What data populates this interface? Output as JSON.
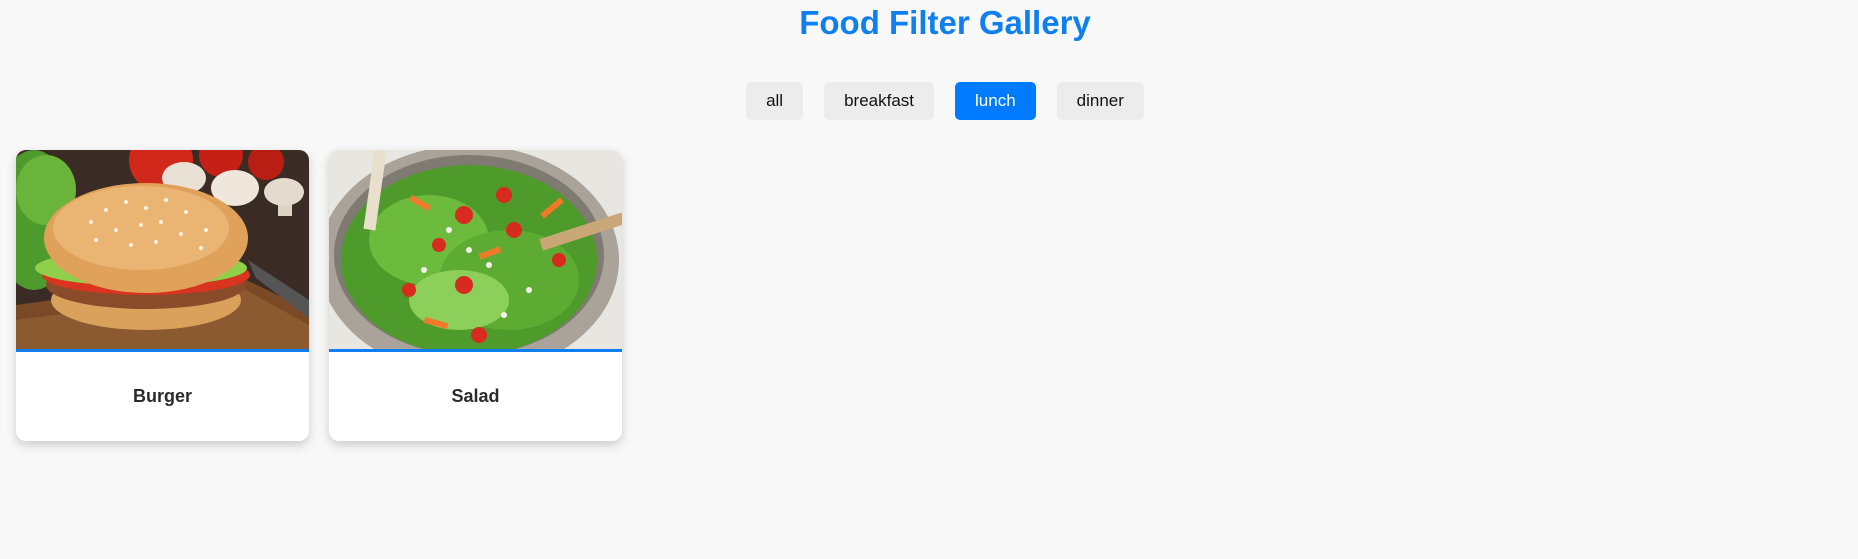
{
  "page": {
    "title": "Food Filter Gallery"
  },
  "filters": {
    "active": "lunch",
    "items": [
      {
        "label": "all"
      },
      {
        "label": "breakfast"
      },
      {
        "label": "lunch"
      },
      {
        "label": "dinner"
      }
    ]
  },
  "cards": [
    {
      "title": "Burger"
    },
    {
      "title": "Salad"
    }
  ],
  "colors": {
    "accent": "#0d7ff0",
    "active_button": "#007bff",
    "button_bg": "#ececec",
    "page_bg": "#f8f8f8"
  }
}
